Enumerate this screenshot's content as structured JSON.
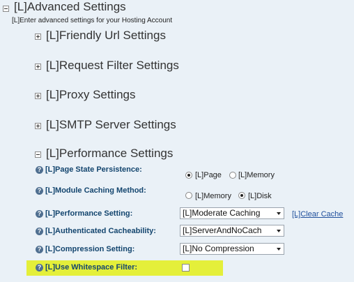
{
  "advanced": {
    "title": "[L]Advanced Settings",
    "subtitle": "[L]Enter advanced settings for your Hosting Account"
  },
  "sections": [
    {
      "label": "[L]Friendly Url Settings"
    },
    {
      "label": "[L]Request Filter Settings"
    },
    {
      "label": "[L]Proxy Settings"
    },
    {
      "label": "[L]SMTP Server Settings"
    },
    {
      "label": "[L]Performance Settings"
    }
  ],
  "performance": {
    "page_state": {
      "label": "[L]Page State Persistence:",
      "options": [
        "[L]Page",
        "[L]Memory"
      ],
      "selected": "[L]Page"
    },
    "module_caching": {
      "label": "[L]Module Caching Method:",
      "options": [
        "[L]Memory",
        "[L]Disk"
      ],
      "selected": "[L]Disk"
    },
    "performance_setting": {
      "label": "[L]Performance Setting:",
      "value": "[L]Moderate Caching",
      "clear_cache_link": "[L]Clear Cache"
    },
    "authenticated_cacheability": {
      "label": "[L]Authenticated Cacheability:",
      "value": "[L]ServerAndNoCach"
    },
    "compression": {
      "label": "[L]Compression Setting:",
      "value": "[L]No Compression"
    },
    "whitespace": {
      "label": "[L]Use Whitespace Filter:",
      "checked": false
    }
  },
  "colors": {
    "background": "#eaf1f7",
    "label": "#13456e",
    "highlight": "#e4ef3a",
    "link": "#1f4f9c"
  },
  "icons": {
    "collapse": "minus-toggle-icon",
    "expand": "plus-toggle-icon",
    "help": "help-icon"
  }
}
